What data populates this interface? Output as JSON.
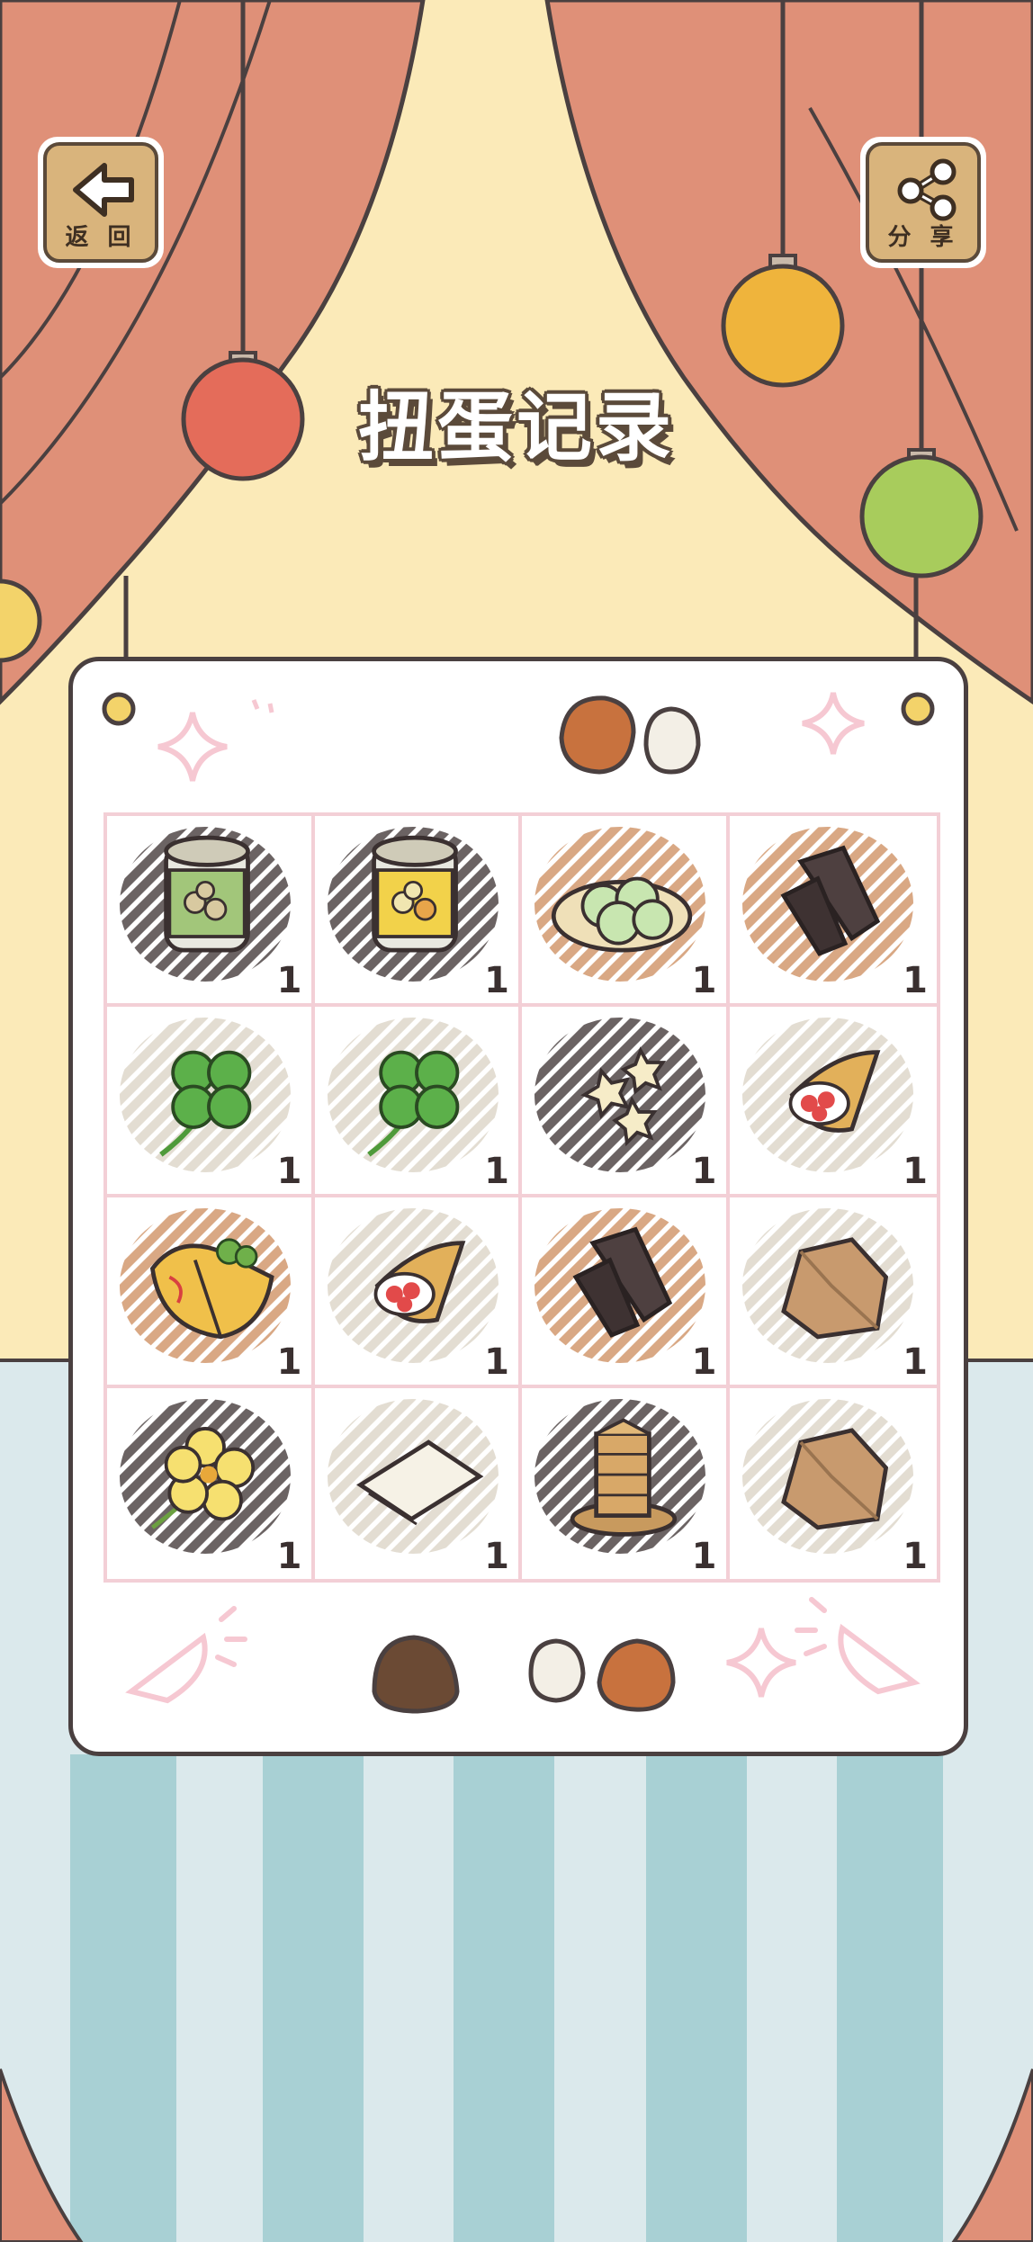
{
  "header": {
    "back_label": "返 回",
    "share_label": "分 享",
    "title": "扭蛋记录"
  },
  "colors": {
    "curtain": "#df9078",
    "wall": "#fbeab8",
    "floor": "#dbe9ec",
    "stripe": "#a8d0d4",
    "button_wood": "#d9b47c",
    "ornament_red": "#e46c5a",
    "ornament_orange": "#efb43c",
    "ornament_green": "#a8cc5c"
  },
  "record_grid": {
    "items": [
      {
        "name": "clover-can",
        "count": "1",
        "hatch": "dark"
      },
      {
        "name": "corn-can",
        "count": "1",
        "hatch": "dark"
      },
      {
        "name": "dumpling-plate",
        "count": "1",
        "hatch": "brown"
      },
      {
        "name": "dark-bark",
        "count": "1",
        "hatch": "brown"
      },
      {
        "name": "four-leaf-clover",
        "count": "1",
        "hatch": "light"
      },
      {
        "name": "four-leaf-clover",
        "count": "1",
        "hatch": "light"
      },
      {
        "name": "star-cookies",
        "count": "1",
        "hatch": "dark"
      },
      {
        "name": "strawberry-crepe",
        "count": "1",
        "hatch": "light"
      },
      {
        "name": "omelette-wrap",
        "count": "1",
        "hatch": "brown"
      },
      {
        "name": "strawberry-crepe",
        "count": "1",
        "hatch": "light"
      },
      {
        "name": "dark-bark",
        "count": "1",
        "hatch": "brown"
      },
      {
        "name": "brown-rock",
        "count": "1",
        "hatch": "light"
      },
      {
        "name": "yellow-flower",
        "count": "1",
        "hatch": "dark"
      },
      {
        "name": "rice-paper",
        "count": "1",
        "hatch": "light"
      },
      {
        "name": "tree-stump-stack",
        "count": "1",
        "hatch": "dark"
      },
      {
        "name": "brown-rock",
        "count": "1",
        "hatch": "light"
      }
    ]
  }
}
